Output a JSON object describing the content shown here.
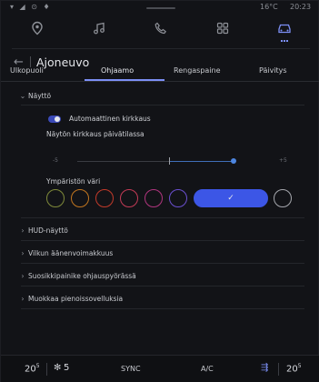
{
  "status_bar": {
    "left_icons": "▾ ◢ ⊙ ♦",
    "temperature": "16°C",
    "clock": "20:23"
  },
  "nav": {
    "icons": [
      {
        "name": "location-pin-icon",
        "active": false
      },
      {
        "name": "music-note-icon",
        "active": false
      },
      {
        "name": "phone-icon",
        "active": false
      },
      {
        "name": "apps-grid-icon",
        "active": false
      },
      {
        "name": "car-icon",
        "active": true
      }
    ]
  },
  "header": {
    "back": "←",
    "title": "Ajoneuvo"
  },
  "tabs": [
    {
      "label": "Ulkopuoli",
      "active": false
    },
    {
      "label": "Ohjaamo",
      "active": true
    },
    {
      "label": "Rengaspaine",
      "active": false
    },
    {
      "label": "Päivitys",
      "active": false
    }
  ],
  "display_section": {
    "label": "Näyttö",
    "auto_brightness_label": "Automaattinen kirkkaus",
    "auto_brightness_on": true,
    "brightness_label": "Näytön kirkkaus päivätilassa",
    "slider_min": "-5",
    "slider_max": "+5",
    "slider_value": 3,
    "ambient_label": "Ympäristön väri",
    "swatches": [
      {
        "color": "#7f8a3a",
        "selected": false
      },
      {
        "color": "#c0751f",
        "selected": false
      },
      {
        "color": "#c23a2a",
        "selected": false
      },
      {
        "color": "#c23a55",
        "selected": false
      },
      {
        "color": "#b0357e",
        "selected": false
      },
      {
        "color": "#6a4fcf",
        "selected": false
      },
      {
        "color": "#3c56e6",
        "selected": true,
        "check": "✓"
      },
      {
        "color": "#a5a7ad",
        "selected": false
      }
    ]
  },
  "collapsed_sections": [
    {
      "label": "HUD-näyttö"
    },
    {
      "label": "Vilkun äänenvoimakkuus"
    },
    {
      "label": "Suosikkipainike ohjauspyörässä"
    },
    {
      "label": "Muokkaa pienoissovelluksia"
    }
  ],
  "climate_bar": {
    "left_temp": "20",
    "left_temp_suffix": "5",
    "fan_level": "5",
    "sync_label": "SYNC",
    "ac_label": "A/C",
    "right_temp": "20",
    "right_temp_suffix": "5"
  },
  "colors": {
    "accent": "#7c8ff5",
    "selected_swatch": "#3c56e6",
    "background": "#121317"
  }
}
